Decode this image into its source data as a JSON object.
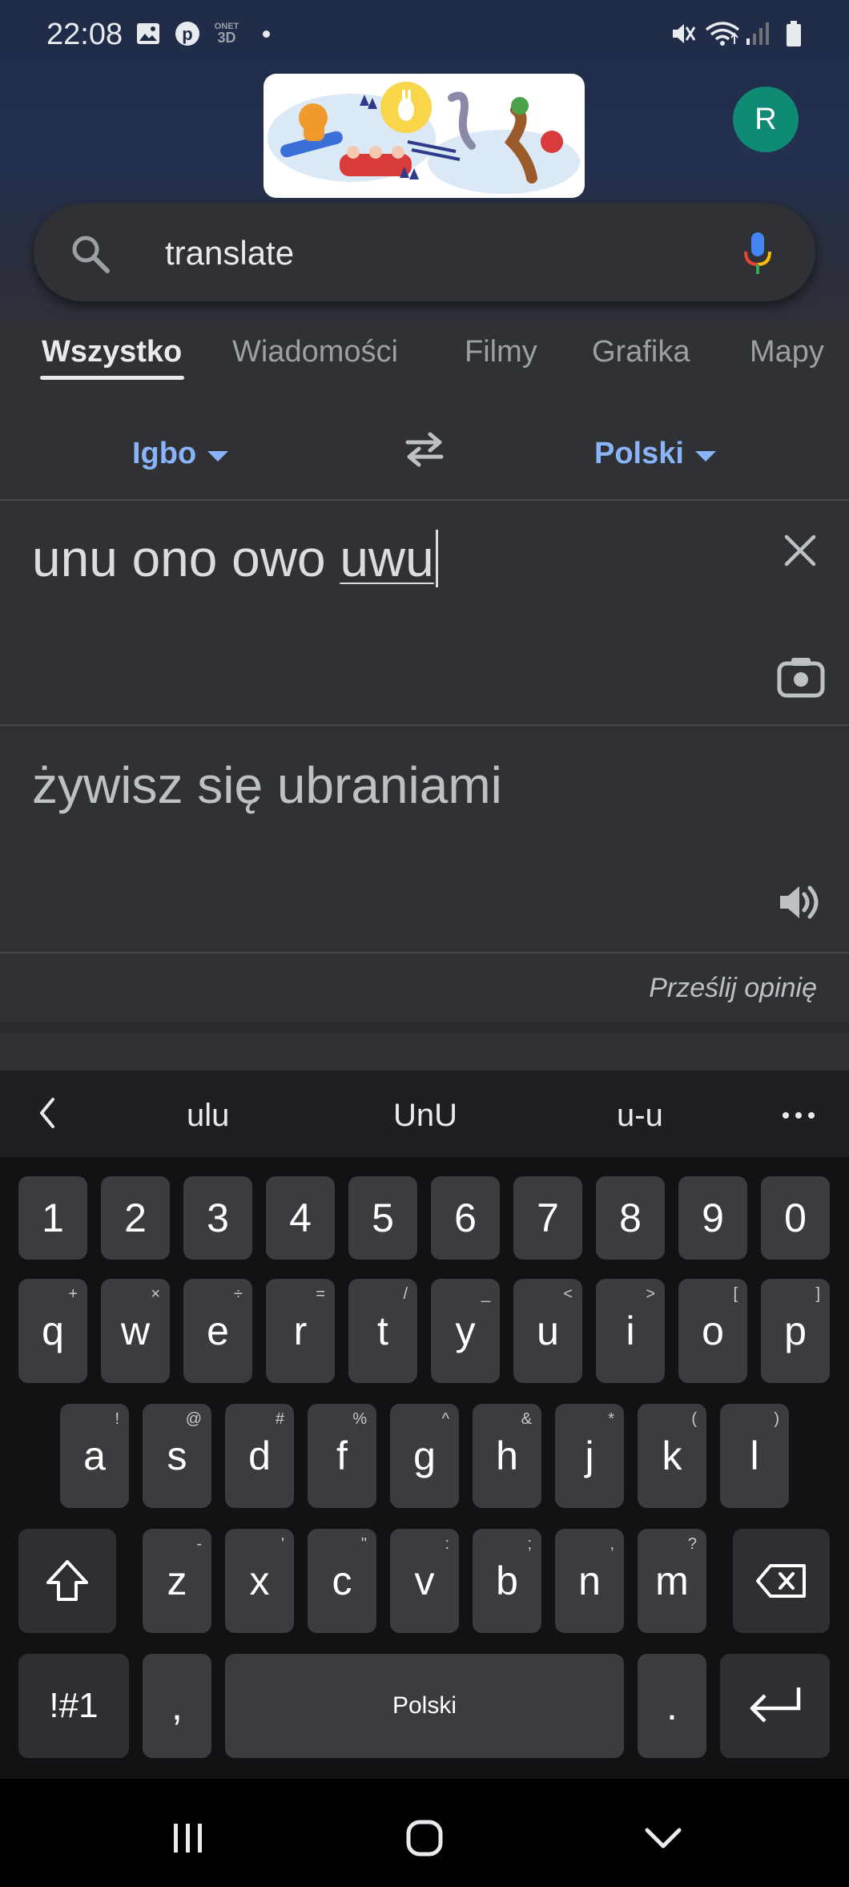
{
  "status_bar": {
    "time": "22:08",
    "onet_label_top": "ONET",
    "onet_label_bottom": "3D",
    "icons": [
      "gallery-icon",
      "pinterest-icon",
      "onet-icon",
      "dot-icon",
      "mute-icon",
      "wifi-icon",
      "signal-icon",
      "battery-icon"
    ]
  },
  "header": {
    "avatar_letter": "R",
    "search_query": "translate"
  },
  "tabs": [
    "Wszystko",
    "Wiadomości",
    "Filmy",
    "Grafika",
    "Mapy"
  ],
  "translate": {
    "source_lang": "Igbo",
    "target_lang": "Polski",
    "source_text_prefix": "unu ono owo ",
    "source_text_composing": "uwu",
    "target_text": "żywisz się ubraniami",
    "feedback_label": "Prześlij opinię"
  },
  "keyboard": {
    "suggestions": [
      "ulu",
      "UnU",
      "u-u"
    ],
    "number_row": [
      "1",
      "2",
      "3",
      "4",
      "5",
      "6",
      "7",
      "8",
      "9",
      "0"
    ],
    "row1": [
      {
        "k": "q",
        "h": "+"
      },
      {
        "k": "w",
        "h": "×"
      },
      {
        "k": "e",
        "h": "÷"
      },
      {
        "k": "r",
        "h": "="
      },
      {
        "k": "t",
        "h": "/"
      },
      {
        "k": "y",
        "h": "_"
      },
      {
        "k": "u",
        "h": "<"
      },
      {
        "k": "i",
        "h": ">"
      },
      {
        "k": "o",
        "h": "["
      },
      {
        "k": "p",
        "h": "]"
      }
    ],
    "row2": [
      {
        "k": "a",
        "h": "!"
      },
      {
        "k": "s",
        "h": "@"
      },
      {
        "k": "d",
        "h": "#"
      },
      {
        "k": "f",
        "h": "%"
      },
      {
        "k": "g",
        "h": "^"
      },
      {
        "k": "h",
        "h": "&"
      },
      {
        "k": "j",
        "h": "*"
      },
      {
        "k": "k",
        "h": "("
      },
      {
        "k": "l",
        "h": ")"
      }
    ],
    "row3": [
      {
        "k": "z",
        "h": "-"
      },
      {
        "k": "x",
        "h": "'"
      },
      {
        "k": "c",
        "h": "\""
      },
      {
        "k": "v",
        "h": ":"
      },
      {
        "k": "b",
        "h": ";"
      },
      {
        "k": "n",
        "h": ","
      },
      {
        "k": "m",
        "h": "?"
      }
    ],
    "symbols_label": "!#1",
    "comma": ",",
    "space_label": "Polski",
    "period": "."
  },
  "colors": {
    "accent_blue": "#8ab4f8",
    "avatar_green": "#0f8a74",
    "background": "#303134"
  }
}
